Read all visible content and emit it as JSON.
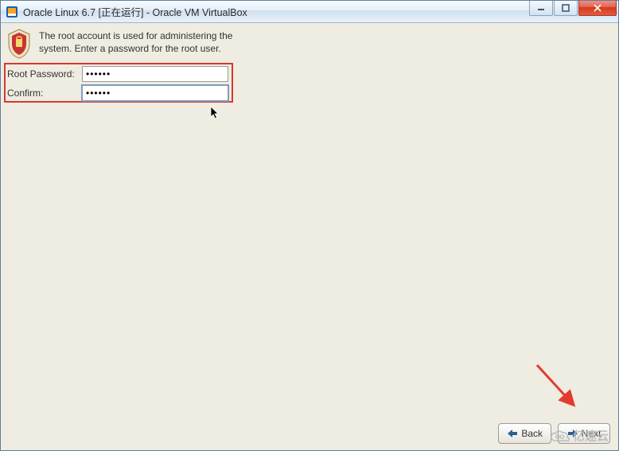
{
  "title": "Oracle Linux 6.7 [正在运行] - Oracle VM VirtualBox",
  "description": "The root account is used for administering the system.  Enter a password for the root user.",
  "form": {
    "root_password_label": "Root Password:",
    "root_password_value": "••••••",
    "confirm_label": "Confirm:",
    "confirm_value": "••••••"
  },
  "buttons": {
    "back": "Back",
    "next": "Next"
  },
  "watermark_text": "亿速云",
  "colors": {
    "highlight_border": "#d63a2f",
    "arrow": "#e33b2e"
  }
}
